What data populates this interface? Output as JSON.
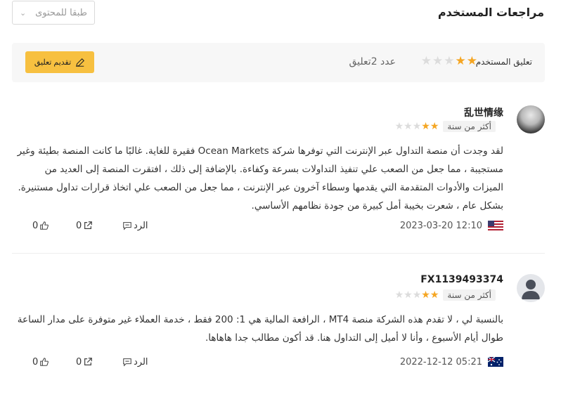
{
  "header": {
    "title": "مراجعات المستخدم",
    "sort_select": "طبقا للمحتوى"
  },
  "summary": {
    "label": "تعليق المستخدم",
    "rating_stars": 2,
    "max_stars": 5,
    "count_text": "عدد 2تعليق",
    "submit_label": "تقديم تعليق",
    "colors": {
      "accent": "#f7c040",
      "star_on": "#f5a623",
      "star_off": "#dcdcdc"
    }
  },
  "reviews": [
    {
      "username": "乱世情缘",
      "time_ago": "أكثر من سنة",
      "stars": 2,
      "text": "لقد وجدت أن منصة التداول عبر الإنترنت التي توفرها شركة Ocean Markets فقيرة للغاية. غالبًا ما كانت المنصة بطيئة وغير مستجيبة ، مما جعل من الصعب علي تنفيذ التداولات بسرعة وكفاءة. بالإضافة إلى ذلك ، افتقرت المنصة إلى العديد من الميزات والأدوات المتقدمة التي يقدمها وسطاء آخرون عبر الإنترنت ، مما جعل من الصعب علي اتخاذ قرارات تداول مستنيرة. بشكل عام ، شعرت بخيبة أمل كبيرة من جودة نظامهم الأساسي.",
      "date": "2023-03-20 12:10",
      "flag": "us-flag",
      "reply_label": "الرد",
      "share_count": "0",
      "like_count": "0"
    },
    {
      "username": "FX1139493374",
      "time_ago": "أكثر من سنة",
      "stars": 2,
      "text": "بالنسبة لي ، لا تقدم هذه الشركة منصة MT4 ، الرافعة المالية هي 1: 200 فقط ، خدمة العملاء غير متوفرة على مدار الساعة طوال أيام الأسبوع ، وأنا لا أميل إلى التداول هنا. قد أكون مطالب جدا هاهاها.",
      "date": "2022-12-12 05:21",
      "flag": "au-flag",
      "reply_label": "الرد",
      "share_count": "0",
      "like_count": "0"
    }
  ]
}
